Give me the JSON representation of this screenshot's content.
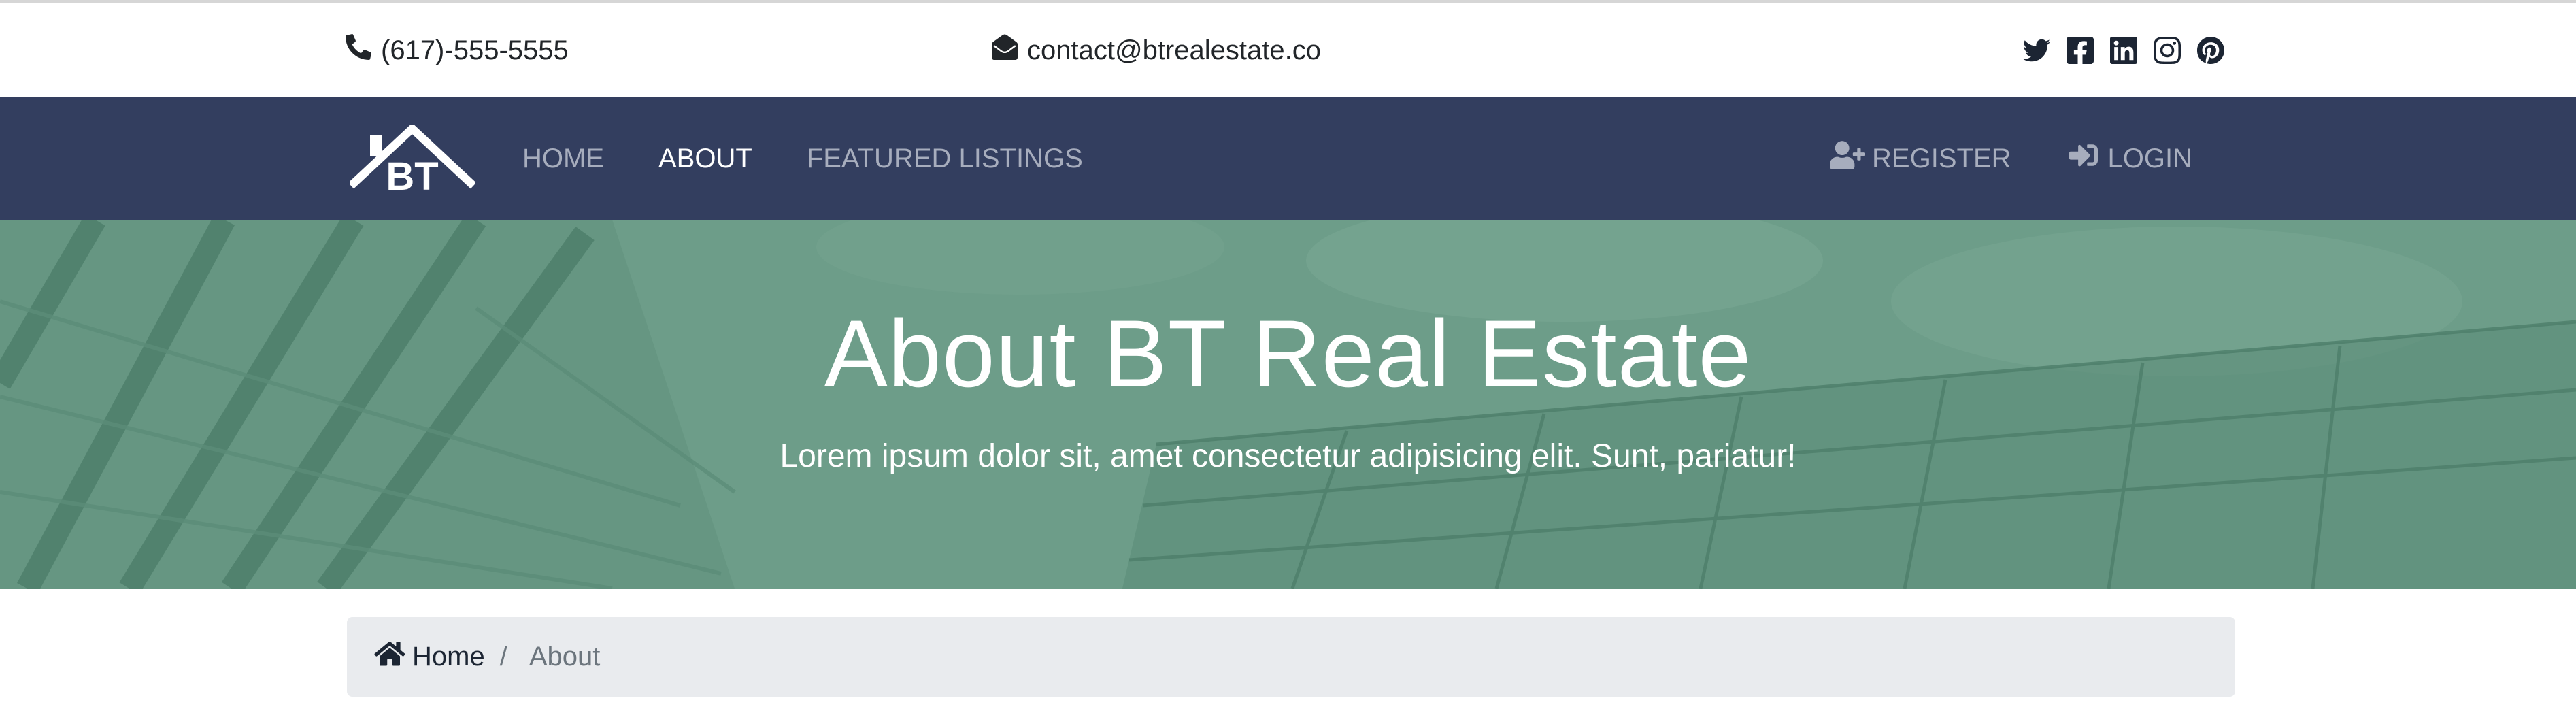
{
  "topbar": {
    "phone": "(617)-555-5555",
    "email": "contact@btrealestate.co",
    "social_icons": [
      "twitter-icon",
      "facebook-icon",
      "linkedin-icon",
      "instagram-icon",
      "pinterest-icon"
    ]
  },
  "navbar": {
    "logo_text": "BT",
    "links": [
      {
        "label": "HOME",
        "active": false
      },
      {
        "label": "ABOUT",
        "active": true
      },
      {
        "label": "FEATURED LISTINGS",
        "active": false
      }
    ],
    "register_label": "REGISTER",
    "login_label": "LOGIN",
    "bg_color": "#333e5f"
  },
  "hero": {
    "title": "About BT Real Estate",
    "subtitle": "Lorem ipsum dolor sit, amet consectetur adipisicing elit. Sunt, pariatur!",
    "overlay_color": "#6d9d89"
  },
  "breadcrumb": {
    "home_label": "Home",
    "separator": "/",
    "current_label": "About"
  }
}
